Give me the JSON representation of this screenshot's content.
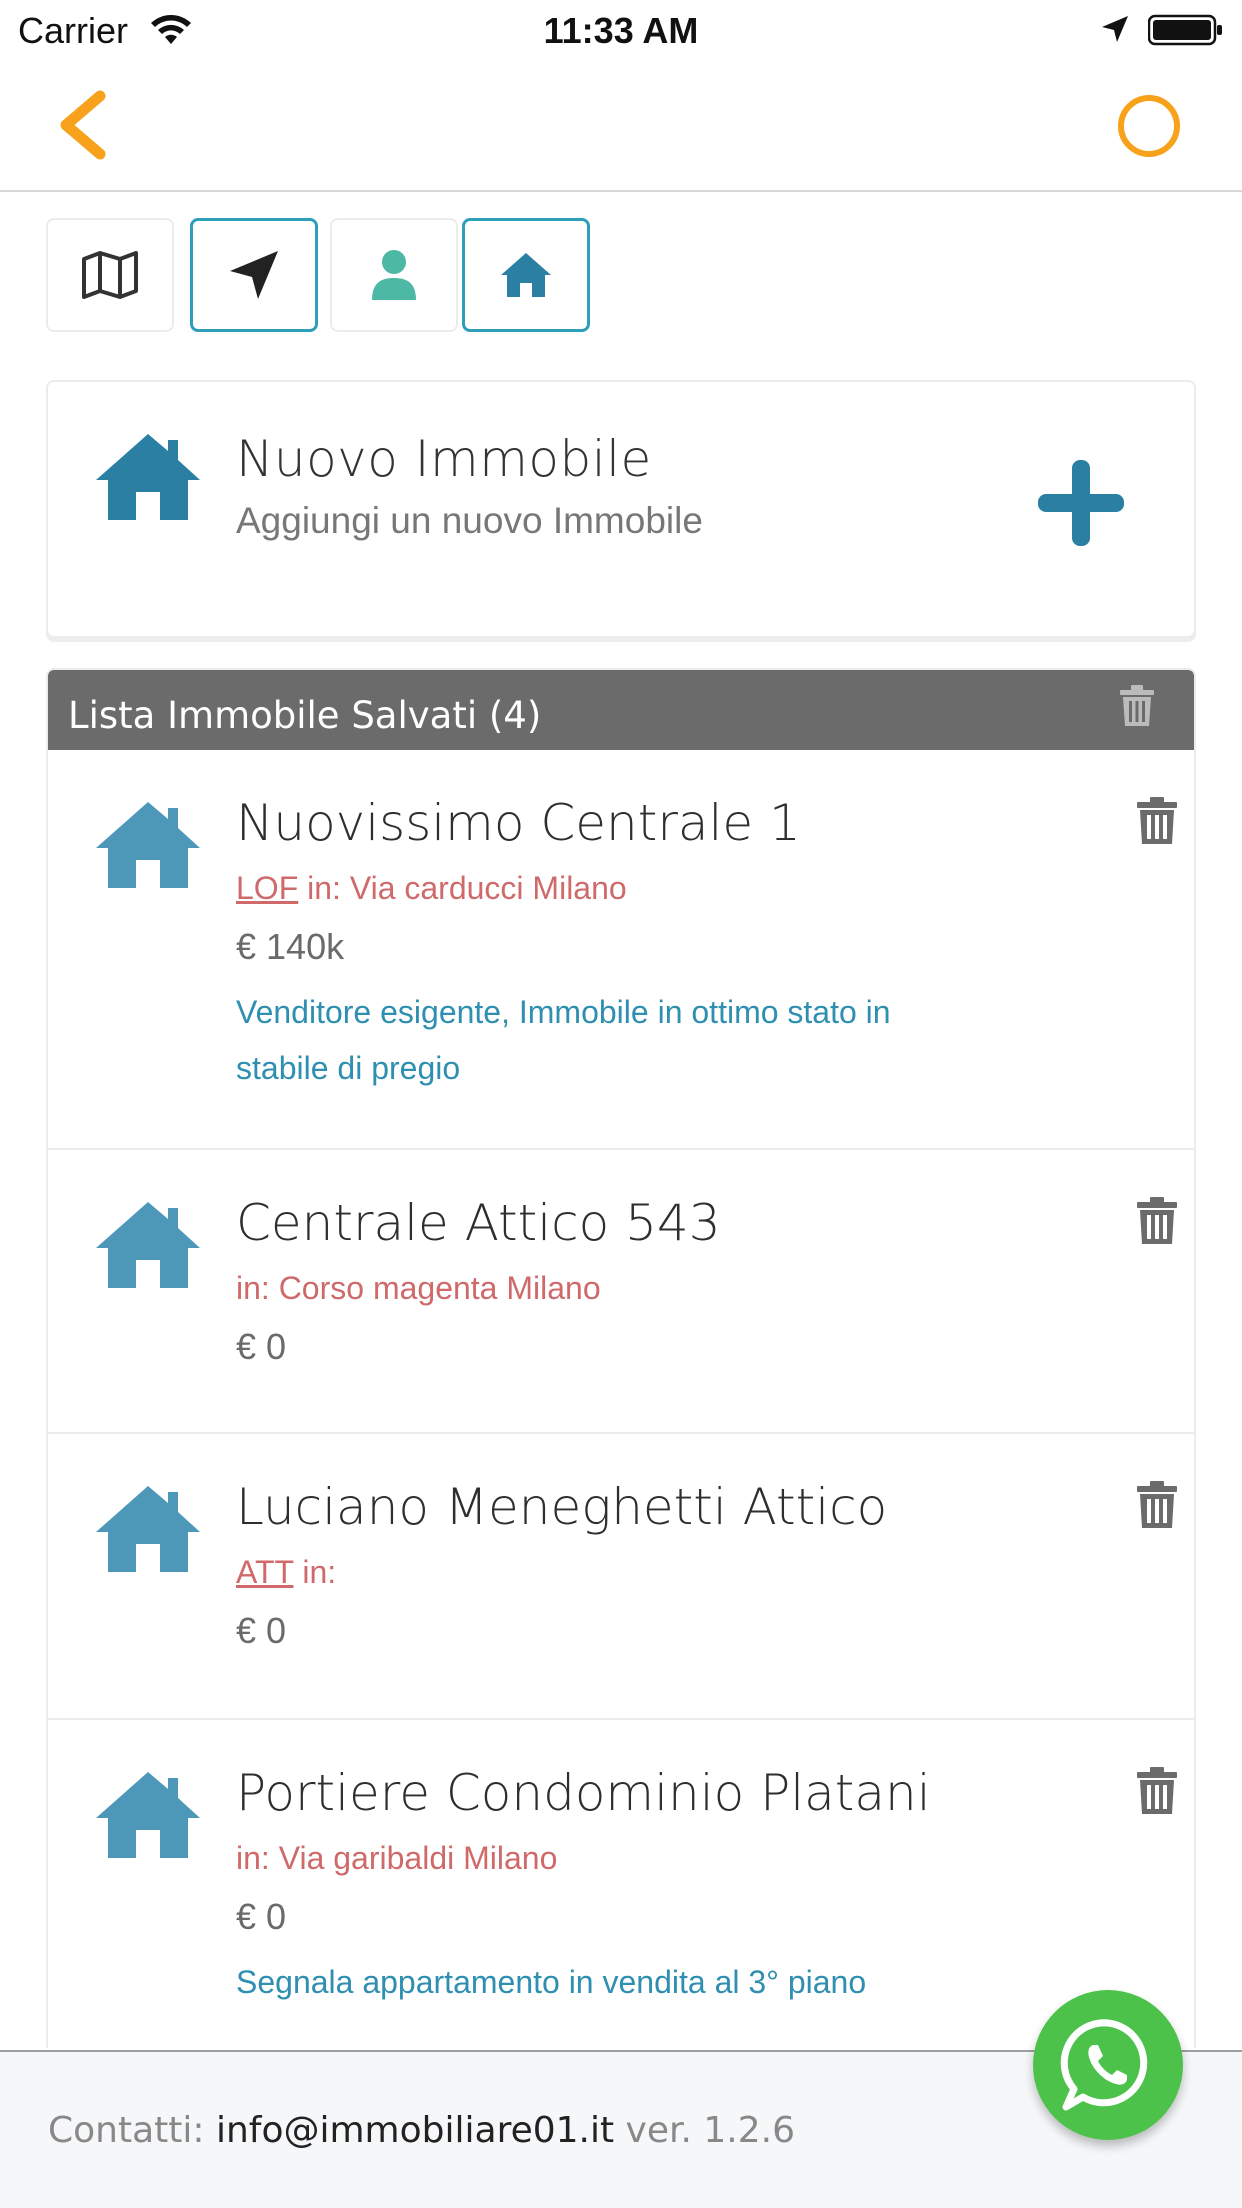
{
  "status_bar": {
    "carrier": "Carrier",
    "time": "11:33 AM",
    "icons": [
      "wifi-icon",
      "location-arrow-icon",
      "battery-icon"
    ]
  },
  "nav": {
    "back_icon": "chevron-left-icon",
    "right_icon": "circle-icon",
    "accent_color": "#f7a21a"
  },
  "tabs": [
    {
      "icon": "map-icon",
      "active": false
    },
    {
      "icon": "location-arrow-icon",
      "active": true
    },
    {
      "icon": "user-icon",
      "active": false
    },
    {
      "icon": "home-icon",
      "active": true
    }
  ],
  "new_card": {
    "title": "Nuovo Immobile",
    "subtitle": "Aggiungi un nuovo Immobile",
    "icon": "home-icon",
    "action_icon": "plus-icon"
  },
  "saved_list": {
    "title": "Lista Immobile Salvati (4)",
    "items": [
      {
        "title": "Nuovissimo Centrale 1",
        "code": "LOF",
        "location": " in: Via carducci Milano",
        "price": "€ 140k",
        "note": "Venditore esigente, Immobile in ottimo stato in stabile di pregio"
      },
      {
        "title": "Centrale Attico 543",
        "code": "",
        "location": "in: Corso magenta Milano",
        "price": "€ 0",
        "note": ""
      },
      {
        "title": "Luciano Meneghetti Attico",
        "code": "ATT",
        "location": " in:",
        "price": "€ 0",
        "note": ""
      },
      {
        "title": "Portiere Condominio Platani",
        "code": "",
        "location": "in: Via garibaldi Milano",
        "price": "€ 0",
        "note": "Segnala appartamento in vendita al 3° piano"
      }
    ]
  },
  "footer": {
    "label": "Contatti: ",
    "email": "info@immobiliare01.it",
    "version": " ver. 1.2.6"
  },
  "colors": {
    "brand_blue": "#2a7fa3",
    "location_red": "#d06a6a",
    "note_blue": "#2f8fb0",
    "whatsapp_green": "#4cc24a"
  }
}
